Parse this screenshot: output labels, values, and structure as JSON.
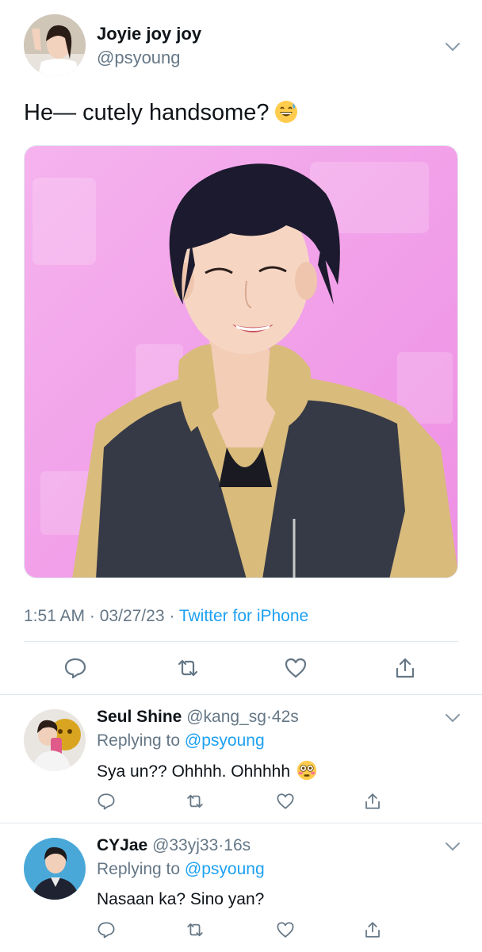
{
  "main_tweet": {
    "author": {
      "display_name": "Joyie joy joy",
      "handle": "@psyoung"
    },
    "text": "He— cutely handsome?",
    "emoji": "grinning-face-with-sweat",
    "meta": {
      "time": "1:51 AM",
      "date": "03/27/23",
      "separator": "·",
      "source": "Twitter for iPhone"
    },
    "actions": [
      "reply-icon",
      "retweet-icon",
      "like-icon",
      "share-icon"
    ]
  },
  "replies": [
    {
      "display_name": "Seul Shine",
      "handle": "@kang_sg",
      "time_sep": "·",
      "time": "42s",
      "replying_prefix": "Replying to",
      "replying_to": "@psyoung",
      "text": "Sya un?? Ohhhh. Ohhhhh",
      "emoji": "flushed-face"
    },
    {
      "display_name": "CYJae",
      "handle": "@33yj33",
      "time_sep": "·",
      "time": "16s",
      "replying_prefix": "Replying to",
      "replying_to": "@psyoung",
      "text": "Nasaan ka? Sino yan?"
    }
  ],
  "colors": {
    "accent": "#1da1f2",
    "secondary_text": "#657786",
    "primary_text": "#0f1419",
    "divider": "#e1e8ed",
    "media_background": "#f2a9ec"
  }
}
